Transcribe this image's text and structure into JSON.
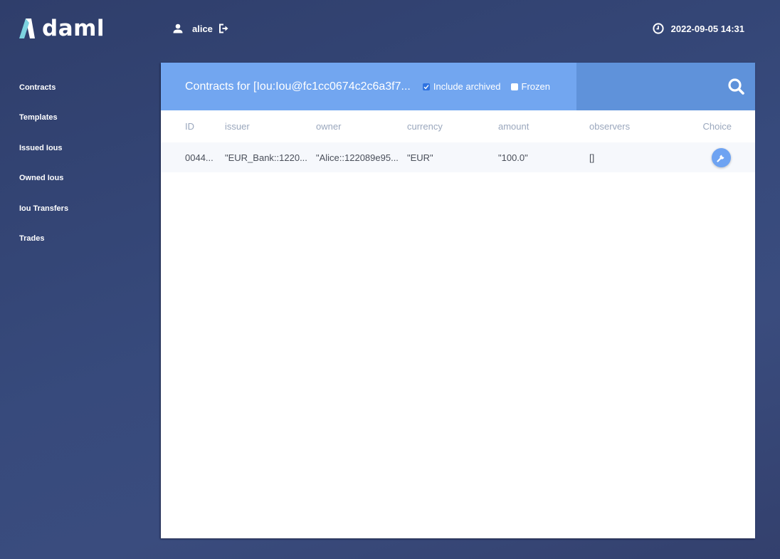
{
  "app": {
    "logo_text": "daml",
    "user_name": "alice",
    "datetime": "2022-09-05 14:31"
  },
  "sidebar": {
    "items": [
      {
        "label": "Contracts"
      },
      {
        "label": "Templates"
      },
      {
        "label": "Issued Ious"
      },
      {
        "label": "Owned Ious"
      },
      {
        "label": "Iou Transfers"
      },
      {
        "label": "Trades"
      }
    ]
  },
  "panel": {
    "title": "Contracts for [Iou:Iou@fc1cc0674c2c6a3f7...",
    "include_archived": {
      "label": "Include archived",
      "checked": true
    },
    "frozen": {
      "label": "Frozen",
      "checked": false
    },
    "columns": [
      "ID",
      "issuer",
      "owner",
      "currency",
      "amount",
      "observers",
      "Choice"
    ],
    "rows": [
      {
        "id": "0044...",
        "issuer": "\"EUR_Bank::1220...",
        "owner": "\"Alice::122089e95...",
        "currency": "\"EUR\"",
        "amount": "\"100.0\"",
        "observers": "[]"
      }
    ]
  },
  "colors": {
    "background": "#34467a",
    "header_accent": "#72a6f0",
    "search_area": "#5f92da",
    "logo_accent": "#7dd3e0",
    "choice_button": "#6ea3f2"
  }
}
